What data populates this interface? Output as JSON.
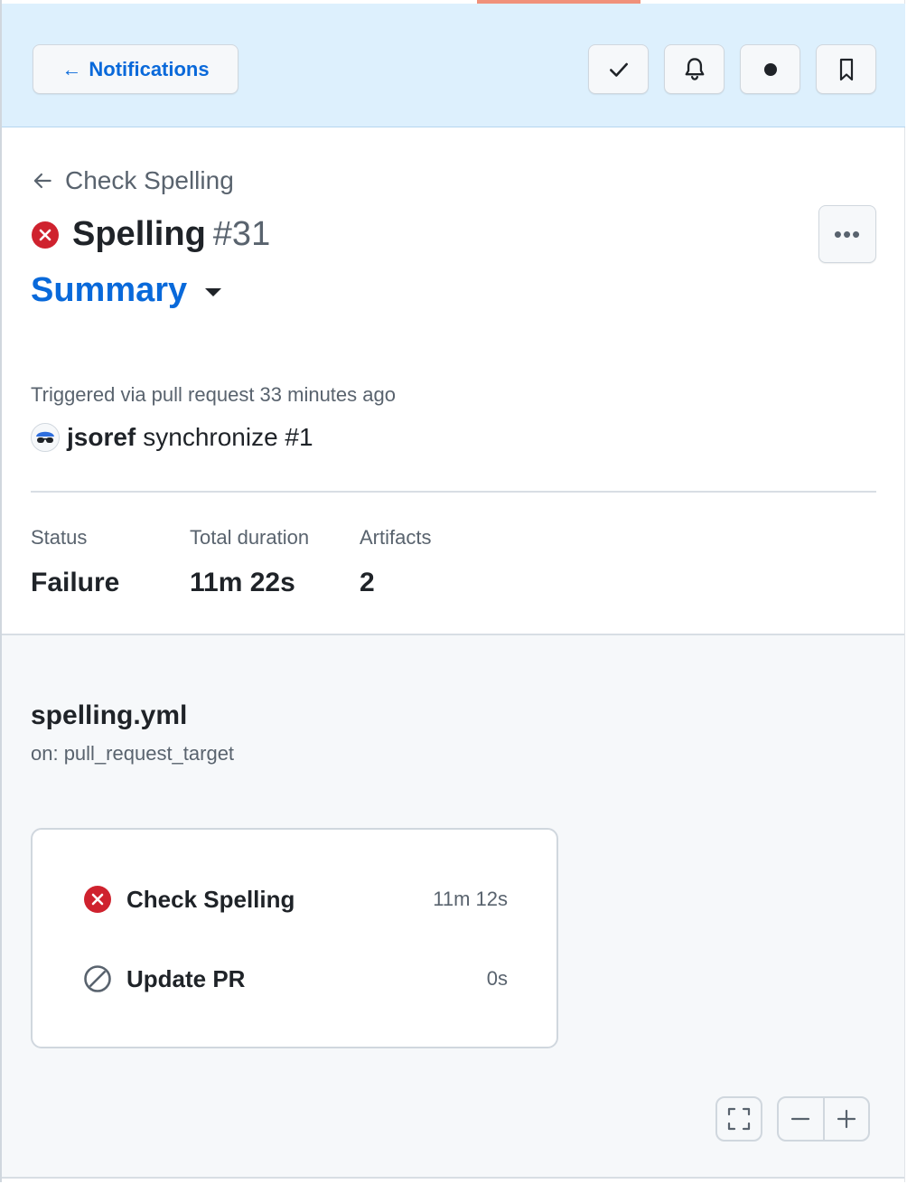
{
  "header": {
    "back_label": "Notifications",
    "actions": [
      {
        "name": "mark-done",
        "icon": "check-icon"
      },
      {
        "name": "subscribe",
        "icon": "bell-icon"
      },
      {
        "name": "mark-unread",
        "icon": "dot-icon"
      },
      {
        "name": "save",
        "icon": "bookmark-icon"
      }
    ]
  },
  "run": {
    "breadcrumb": "Check Spelling",
    "title": "Spelling",
    "number": "#31",
    "status_icon": "x-circle-fill-icon",
    "view_label": "Summary",
    "trigger_text": "Triggered via pull request 33 minutes ago",
    "actor": "jsoref",
    "action": "synchronize #1"
  },
  "stats": [
    {
      "label": "Status",
      "value": "Failure"
    },
    {
      "label": "Total duration",
      "value": "11m 22s"
    },
    {
      "label": "Artifacts",
      "value": "2"
    }
  ],
  "workflow": {
    "file": "spelling.yml",
    "trigger": "on: pull_request_target",
    "jobs": [
      {
        "name": "Check Spelling",
        "duration": "11m 12s",
        "status": "failure",
        "icon": "x-circle-fill-icon"
      },
      {
        "name": "Update PR",
        "duration": "0s",
        "status": "skipped",
        "icon": "skip-icon"
      }
    ]
  },
  "colors": {
    "accent": "#0969da",
    "failure": "#cf222e",
    "header_bg": "#ddf0fd",
    "muted": "#59636e"
  }
}
